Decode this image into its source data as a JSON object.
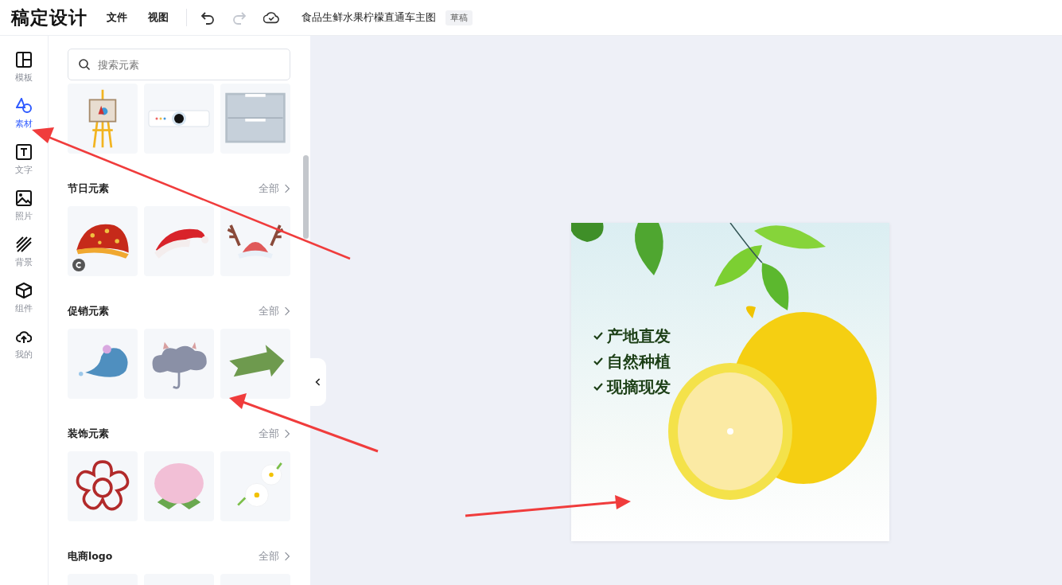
{
  "header": {
    "logo": "稿定设计",
    "menu": [
      {
        "label": "文件"
      },
      {
        "label": "视图"
      }
    ],
    "tools": [
      {
        "kind": "undo",
        "disabled": false
      },
      {
        "kind": "redo",
        "disabled": true
      },
      {
        "kind": "cloud",
        "disabled": false
      }
    ],
    "document": {
      "title": "食品生鲜水果柠檬直通车主图",
      "status": "草稿"
    }
  },
  "nav": [
    {
      "kind": "template",
      "label": "模板",
      "selected": false
    },
    {
      "kind": "shapes",
      "label": "素材",
      "selected": true
    },
    {
      "kind": "text",
      "label": "文字",
      "selected": false
    },
    {
      "kind": "photo",
      "label": "照片",
      "selected": false
    },
    {
      "kind": "background",
      "label": "背景",
      "selected": false
    },
    {
      "kind": "component",
      "label": "组件",
      "selected": false
    },
    {
      "kind": "upload",
      "label": "我的",
      "selected": false
    }
  ],
  "panel": {
    "search": {
      "placeholder": "搜索元素"
    },
    "top_items": [
      {
        "kind": "easel",
        "copyright": false
      },
      {
        "kind": "projector",
        "copyright": false
      },
      {
        "kind": "drawer",
        "copyright": false
      }
    ],
    "sections": [
      {
        "title": "节日元素",
        "more": "全部",
        "items": [
          {
            "kind": "jester-hat",
            "copyright": true
          },
          {
            "kind": "santa-hat",
            "copyright": false
          },
          {
            "kind": "antlers",
            "copyright": false
          }
        ]
      },
      {
        "title": "促销元素",
        "more": "全部",
        "items": [
          {
            "kind": "bubble",
            "copyright": false
          },
          {
            "kind": "cloud-umbrella",
            "copyright": false
          },
          {
            "kind": "arrow-sign",
            "copyright": false
          }
        ]
      },
      {
        "title": "装饰元素",
        "more": "全部",
        "items": [
          {
            "kind": "flower-outline",
            "copyright": false
          },
          {
            "kind": "hydrangea",
            "copyright": false
          },
          {
            "kind": "daisies",
            "copyright": false
          }
        ]
      },
      {
        "title": "电商logo",
        "more": "全部",
        "items": [
          {
            "kind": "blank"
          },
          {
            "kind": "blank"
          },
          {
            "kind": "blank"
          }
        ]
      }
    ]
  },
  "canvas": {
    "features": [
      "产地直发",
      "自然种植",
      "现摘现发"
    ]
  }
}
